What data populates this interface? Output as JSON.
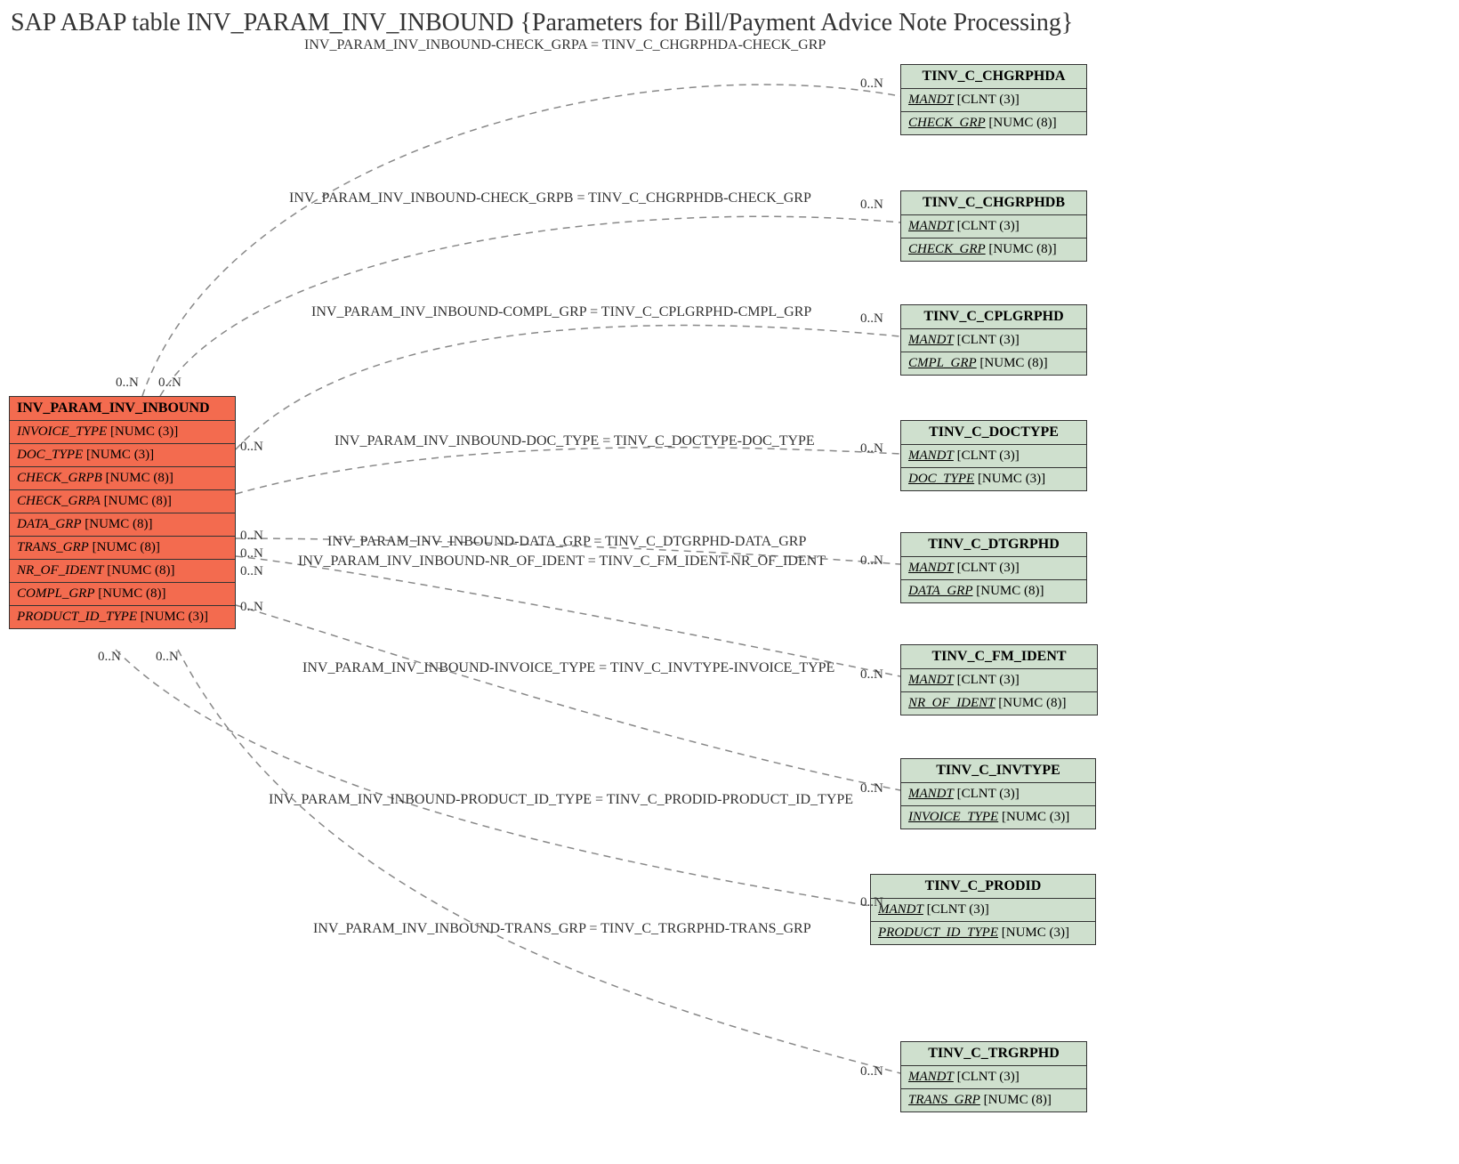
{
  "title": "SAP ABAP table INV_PARAM_INV_INBOUND {Parameters for Bill/Payment Advice Note Processing}",
  "main": {
    "name": "INV_PARAM_INV_INBOUND",
    "fields": [
      {
        "name": "INVOICE_TYPE",
        "type": "[NUMC (3)]"
      },
      {
        "name": "DOC_TYPE",
        "type": "[NUMC (3)]"
      },
      {
        "name": "CHECK_GRPB",
        "type": "[NUMC (8)]"
      },
      {
        "name": "CHECK_GRPA",
        "type": "[NUMC (8)]"
      },
      {
        "name": "DATA_GRP",
        "type": "[NUMC (8)]"
      },
      {
        "name": "TRANS_GRP",
        "type": "[NUMC (8)]"
      },
      {
        "name": "NR_OF_IDENT",
        "type": "[NUMC (8)]"
      },
      {
        "name": "COMPL_GRP",
        "type": "[NUMC (8)]"
      },
      {
        "name": "PRODUCT_ID_TYPE",
        "type": "[NUMC (3)]"
      }
    ]
  },
  "targets": [
    {
      "name": "TINV_C_CHGRPHDA",
      "f1name": "MANDT",
      "f1type": "[CLNT (3)]",
      "f2name": "CHECK_GRP",
      "f2type": "[NUMC (8)]"
    },
    {
      "name": "TINV_C_CHGRPHDB",
      "f1name": "MANDT",
      "f1type": "[CLNT (3)]",
      "f2name": "CHECK_GRP",
      "f2type": "[NUMC (8)]"
    },
    {
      "name": "TINV_C_CPLGRPHD",
      "f1name": "MANDT",
      "f1type": "[CLNT (3)]",
      "f2name": "CMPL_GRP",
      "f2type": "[NUMC (8)]"
    },
    {
      "name": "TINV_C_DOCTYPE",
      "f1name": "MANDT",
      "f1type": "[CLNT (3)]",
      "f2name": "DOC_TYPE",
      "f2type": "[NUMC (3)]"
    },
    {
      "name": "TINV_C_DTGRPHD",
      "f1name": "MANDT",
      "f1type": "[CLNT (3)]",
      "f2name": "DATA_GRP",
      "f2type": "[NUMC (8)]"
    },
    {
      "name": "TINV_C_FM_IDENT",
      "f1name": "MANDT",
      "f1type": "[CLNT (3)]",
      "f2name": "NR_OF_IDENT",
      "f2type": "[NUMC (8)]"
    },
    {
      "name": "TINV_C_INVTYPE",
      "f1name": "MANDT",
      "f1type": "[CLNT (3)]",
      "f2name": "INVOICE_TYPE",
      "f2type": "[NUMC (3)]"
    },
    {
      "name": "TINV_C_PRODID",
      "f1name": "MANDT",
      "f1type": "[CLNT (3)]",
      "f2name": "PRODUCT_ID_TYPE",
      "f2type": "[NUMC (3)]"
    },
    {
      "name": "TINV_C_TRGRPHD",
      "f1name": "MANDT",
      "f1type": "[CLNT (3)]",
      "f2name": "TRANS_GRP",
      "f2type": "[NUMC (8)]"
    }
  ],
  "relations": [
    {
      "label": "INV_PARAM_INV_INBOUND-CHECK_GRPA = TINV_C_CHGRPHDA-CHECK_GRP"
    },
    {
      "label": "INV_PARAM_INV_INBOUND-CHECK_GRPB = TINV_C_CHGRPHDB-CHECK_GRP"
    },
    {
      "label": "INV_PARAM_INV_INBOUND-COMPL_GRP = TINV_C_CPLGRPHD-CMPL_GRP"
    },
    {
      "label": "INV_PARAM_INV_INBOUND-DOC_TYPE = TINV_C_DOCTYPE-DOC_TYPE"
    },
    {
      "label": "INV_PARAM_INV_INBOUND-DATA_GRP = TINV_C_DTGRPHD-DATA_GRP"
    },
    {
      "label": "INV_PARAM_INV_INBOUND-NR_OF_IDENT = TINV_C_FM_IDENT-NR_OF_IDENT"
    },
    {
      "label": "INV_PARAM_INV_INBOUND-INVOICE_TYPE = TINV_C_INVTYPE-INVOICE_TYPE"
    },
    {
      "label": "INV_PARAM_INV_INBOUND-PRODUCT_ID_TYPE = TINV_C_PRODID-PRODUCT_ID_TYPE"
    },
    {
      "label": "INV_PARAM_INV_INBOUND-TRANS_GRP = TINV_C_TRGRPHD-TRANS_GRP"
    }
  ],
  "cardinality": "0..N"
}
